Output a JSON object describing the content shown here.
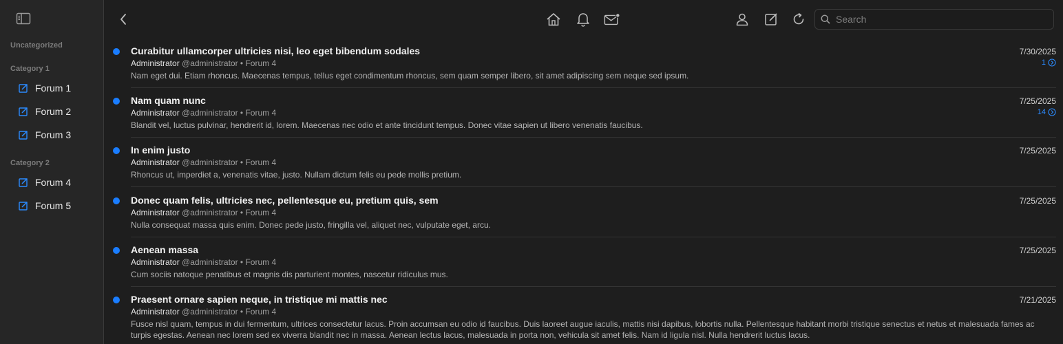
{
  "sidebar": {
    "groups": [
      {
        "label": "Uncategorized",
        "forums": []
      },
      {
        "label": "Category 1",
        "forums": [
          "Forum 1",
          "Forum 2",
          "Forum 3"
        ]
      },
      {
        "label": "Category 2",
        "forums": [
          "Forum 4",
          "Forum 5"
        ]
      }
    ]
  },
  "topbar": {
    "search_placeholder": "Search",
    "icons": [
      "back-icon",
      "home-icon",
      "bell-icon",
      "mail-icon",
      "user-icon",
      "compose-icon",
      "refresh-icon",
      "search-icon"
    ]
  },
  "colors": {
    "accent": "#1a7dff",
    "background": "#1e1e1e",
    "sidebar": "#262626"
  },
  "threads": [
    {
      "title": "Curabitur ullamcorper ultricies nisi, leo eget bibendum sodales",
      "author": "Administrator",
      "handle": "@administrator",
      "forum": "• Forum 4",
      "excerpt": "Nam eget dui. Etiam rhoncus. Maecenas tempus, tellus eget condimentum rhoncus, sem quam semper libero, sit amet adipiscing sem neque sed ipsum.",
      "date": "7/30/2025",
      "replies": "1"
    },
    {
      "title": "Nam quam nunc",
      "author": "Administrator",
      "handle": "@administrator",
      "forum": "• Forum 4",
      "excerpt": "Blandit vel, luctus pulvinar, hendrerit id, lorem. Maecenas nec odio et ante tincidunt tempus. Donec vitae sapien ut libero venenatis faucibus.",
      "date": "7/25/2025",
      "replies": "14"
    },
    {
      "title": "In enim justo",
      "author": "Administrator",
      "handle": "@administrator",
      "forum": "• Forum 4",
      "excerpt": "Rhoncus ut, imperdiet a, venenatis vitae, justo. Nullam dictum felis eu pede mollis pretium.",
      "date": "7/25/2025",
      "replies": ""
    },
    {
      "title": "Donec quam felis, ultricies nec, pellentesque eu, pretium quis, sem",
      "author": "Administrator",
      "handle": "@administrator",
      "forum": "• Forum 4",
      "excerpt": "Nulla consequat massa quis enim. Donec pede justo, fringilla vel, aliquet nec, vulputate eget, arcu.",
      "date": "7/25/2025",
      "replies": ""
    },
    {
      "title": "Aenean massa",
      "author": "Administrator",
      "handle": "@administrator",
      "forum": "• Forum 4",
      "excerpt": "Cum sociis natoque penatibus et magnis dis parturient montes, nascetur ridiculus mus.",
      "date": "7/25/2025",
      "replies": ""
    },
    {
      "title": "Praesent ornare sapien neque, in tristique mi mattis nec",
      "author": "Administrator",
      "handle": "@administrator",
      "forum": "• Forum 4",
      "excerpt": "Fusce nisl quam, tempus in dui fermentum, ultrices consectetur lacus. Proin accumsan eu odio id faucibus. Duis laoreet augue iaculis, mattis nisi dapibus, lobortis nulla. Pellentesque habitant morbi tristique senectus et netus et malesuada fames ac turpis egestas. Aenean nec lorem sed ex viverra blandit nec in massa. Aenean lectus lacus, malesuada in porta non, vehicula sit amet felis. Nam id ligula nisl. Nulla hendrerit luctus lacus.",
      "date": "7/21/2025",
      "replies": ""
    }
  ]
}
